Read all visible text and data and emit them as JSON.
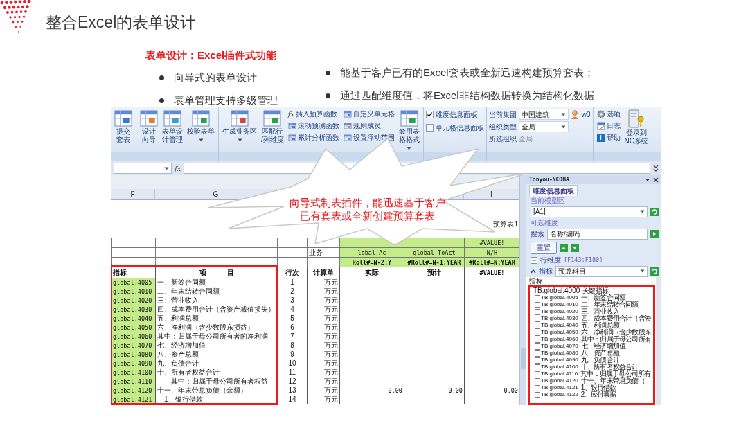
{
  "slide": {
    "title": "整合Excel的表单设计",
    "subtitle": "表单设计：Excel插件式功能",
    "left_bullets": [
      "向导式的表单设计",
      "表单管理支持多级管理"
    ],
    "right_bullets": [
      "能基于客户已有的Excel套表或全新迅速构建预算套表；",
      "通过匹配维度值，将Excel非结构数据转换为结构化数据"
    ]
  },
  "ribbon": {
    "groups": [
      {
        "items": [
          {
            "kind": "large",
            "lines": [
              "提交",
              "套表"
            ],
            "dropdown": false
          }
        ]
      },
      {
        "items": [
          {
            "kind": "large",
            "lines": [
              "设计",
              "向导"
            ],
            "dropdown": false
          },
          {
            "kind": "large",
            "lines": [
              "表单设",
              "计管理"
            ],
            "dropdown": false
          },
          {
            "kind": "large",
            "lines": [
              "校验表单"
            ],
            "dropdown": true
          }
        ]
      },
      {
        "items": [
          {
            "kind": "large",
            "lines": [
              "生成业务区"
            ],
            "dropdown": true
          },
          {
            "kind": "large",
            "lines": [
              "匹配行",
              "/列维度"
            ],
            "dropdown": false
          },
          {
            "kind": "stack",
            "buttons": [
              {
                "glyph": "fx",
                "label": "插入预算函数"
              },
              {
                "label": "滚动预测函数"
              },
              {
                "label": "累计分析函数"
              }
            ]
          },
          {
            "kind": "stack",
            "buttons": [
              {
                "label": "自定义单元格"
              },
              {
                "label": "规则成员"
              },
              {
                "label": "设置浮动范围"
              }
            ]
          },
          {
            "kind": "large",
            "lines": [
              "套用表",
              "格格式"
            ],
            "dropdown": true
          }
        ]
      },
      {
        "items": [
          {
            "kind": "checks",
            "options": [
              {
                "label": "维度信息面板",
                "checked": true
              },
              {
                "label": "单元格信息面板",
                "checked": false
              }
            ]
          }
        ]
      },
      {
        "items": [
          {
            "kind": "org",
            "fields": [
              {
                "label": "当前集团",
                "value": "中国建筑",
                "user": "w3"
              },
              {
                "label": "组织类型",
                "value": "全局"
              }
            ],
            "selected_label": "所选组织",
            "selected_value": "全局"
          }
        ]
      },
      {
        "items": [
          {
            "kind": "stack",
            "buttons": [
              {
                "label": "选项"
              },
              {
                "label": "日志"
              },
              {
                "glyph": "i",
                "label": "帮助"
              }
            ]
          },
          {
            "kind": "large",
            "lines": [
              "登录到",
              "NC系统"
            ],
            "dropdown": false
          }
        ]
      }
    ]
  },
  "formula_bar": {
    "function_glyph": "fx"
  },
  "sheet": {
    "column_letters": [
      "F",
      "G",
      "I"
    ],
    "report_label": "预算表1",
    "business_label": "业务",
    "measure_headers": [
      {
        "lines": [
          "lobal.Ac",
          "Roll#=N-2:Y"
        ]
      },
      {
        "lines": [
          "global.ToAct",
          "#Roll#=N-1:YEAR"
        ]
      },
      {
        "lines": [
          "#VALUE!",
          "N/H",
          "#Roll#=N:YEAR"
        ]
      }
    ],
    "columns": [
      "指标",
      "项　　　目",
      "行次",
      "计算单",
      "实际",
      "预计",
      "#VALUE!"
    ],
    "rows": [
      {
        "code": "global.4005",
        "item": "一、新签合同额",
        "line": "1",
        "unit": "万元"
      },
      {
        "code": "global.4010",
        "item": "二、年末结转合同额",
        "line": "2",
        "unit": "万元"
      },
      {
        "code": "global.4020",
        "item": "三、营业收入",
        "line": "3",
        "unit": "万元"
      },
      {
        "code": "global.4030",
        "item": "四、成本费用合计（含资产减值损失）",
        "line": "4",
        "unit": "万元"
      },
      {
        "code": "global.4040",
        "item": "五、利润总额",
        "line": "5",
        "unit": "万元"
      },
      {
        "code": "global.4050",
        "item": "六、净利润（含少数股东损益）",
        "line": "6",
        "unit": "万元"
      },
      {
        "code": "global.4060",
        "item": "其中：归属于母公司所有者的净利润",
        "line": "7",
        "unit": "万元"
      },
      {
        "code": "global.4070",
        "item": "七、经济增加值",
        "line": "8",
        "unit": "万元"
      },
      {
        "code": "global.4080",
        "item": "八、资产总额",
        "line": "9",
        "unit": "万元"
      },
      {
        "code": "global.4090",
        "item": "九、负债合计",
        "line": "10",
        "unit": "万元"
      },
      {
        "code": "global.4100",
        "item": "十、所有者权益合计",
        "line": "11",
        "unit": "万元"
      },
      {
        "code": "global.4110",
        "item": "　　其中：归属于母公司所有者权益",
        "line": "12",
        "unit": "万元"
      },
      {
        "code": "global.4120",
        "item": "十一、年末带息负债（余额）",
        "line": "13",
        "unit": "万元",
        "values": [
          "0.00",
          "0.00",
          "0.00"
        ]
      },
      {
        "code": "global.4121",
        "item": "　1、银行借款",
        "line": "14",
        "unit": "万元"
      }
    ]
  },
  "callout": {
    "text": "向导式制表插件，能迅速基于客户已有套表或全新创建预算套表"
  },
  "pane": {
    "title": "Tonyou-NCOBA",
    "tab": "维度信息面板",
    "model_label": "当前模型区",
    "model_value": "[A1]",
    "dims_label": "可选维度",
    "search_label": "搜索",
    "search_placeholder": "名称/编码",
    "reset_button": "重置",
    "row_dim_label": "行维度",
    "row_dim_range": "[F143:F180]",
    "dim_label": "指标",
    "dim_value": "预算科目",
    "tree": {
      "header": "指标",
      "root": {
        "label": "TB.global.4000 关键指标",
        "children": [
          {
            "label": "TB.global.4005 一、新签合同额",
            "checked": false
          },
          {
            "label": "TB.global.4010 二、年末结转合同额",
            "checked": false
          },
          {
            "label": "TB.global.4020 三、营业收入",
            "checked": false
          },
          {
            "label": "TB.global.4030 四、成本费用合计（含资",
            "checked": false
          },
          {
            "label": "TB.global.4040 五、利润总额",
            "checked": false
          },
          {
            "label": "TB.global.4050 六、净利润（含少数股东",
            "checked": false
          },
          {
            "label": "TB.global.4060 其中：归属于母公司所有",
            "checked": false
          },
          {
            "label": "TB.global.4070 七、经济增加值",
            "checked": false
          },
          {
            "label": "TB.global.4080 八、资产总额",
            "checked": false
          },
          {
            "label": "TB.global.4090 九、负债合计",
            "checked": false
          },
          {
            "label": "TB.global.4100 十、所有者权益合计",
            "checked": false
          },
          {
            "label": "TB.global.4110 其中：归属于母公司所有",
            "checked": false
          },
          {
            "label": "TB.global.4120 十一、年末带息负债（",
            "checked": false
          },
          {
            "label": "TB.global.4121 1、银行借款",
            "checked": false
          },
          {
            "label": "TB.global.4122 2、应付票据",
            "checked": false
          }
        ]
      }
    }
  }
}
